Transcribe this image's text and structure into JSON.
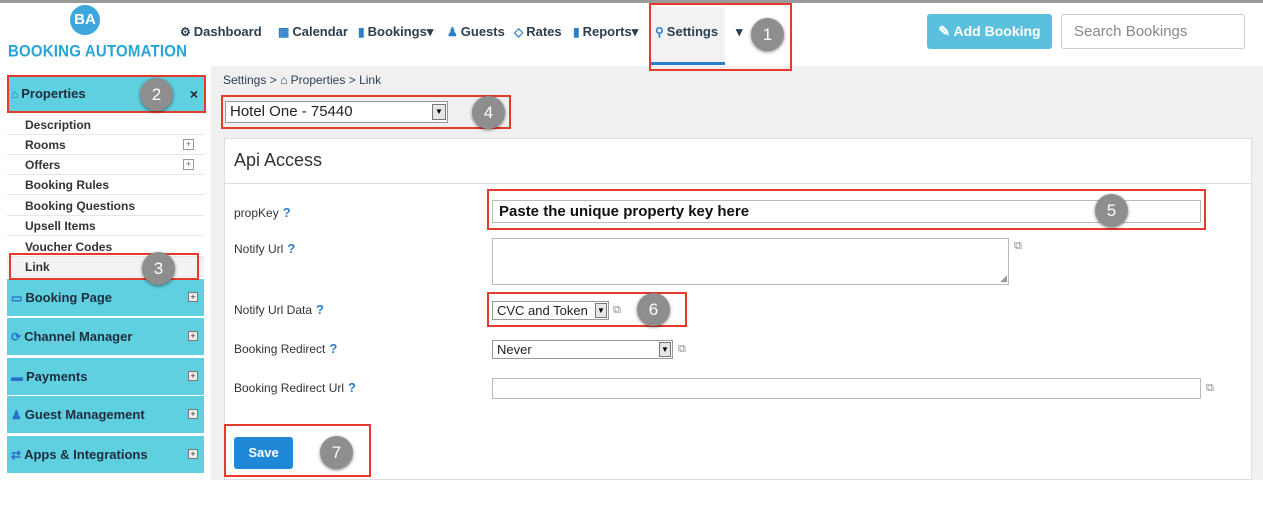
{
  "brand": {
    "logo_mark": "BA",
    "logo_text": "BOOKING AUTOMATION"
  },
  "nav": {
    "items": [
      {
        "label": "Dashboard",
        "icon": "dashboard-icon",
        "glyph": "⚙"
      },
      {
        "label": "Calendar",
        "icon": "calendar-icon",
        "glyph": "▦"
      },
      {
        "label": "Bookings",
        "icon": "bookings-icon",
        "glyph": "▮",
        "caret": "▾"
      },
      {
        "label": "Guests",
        "icon": "guests-icon",
        "glyph": "♟"
      },
      {
        "label": "Rates",
        "icon": "rates-icon",
        "glyph": "◇"
      },
      {
        "label": "Reports",
        "icon": "reports-icon",
        "glyph": "▮",
        "caret": "▾"
      },
      {
        "label": "Settings",
        "icon": "settings-icon",
        "glyph": "⚲"
      }
    ],
    "more_caret": "▾",
    "add_booking": "Add Booking",
    "search_placeholder": "Search Bookings"
  },
  "sidebar": {
    "properties": {
      "label": "Properties",
      "close": "×"
    },
    "sub_items": [
      "Description",
      "Rooms",
      "Offers",
      "Booking Rules",
      "Booking Questions",
      "Upsell Items",
      "Voucher Codes",
      "Link"
    ],
    "sections": [
      "Booking Page",
      "Channel Manager",
      "Payments",
      "Guest Management",
      "Apps & Integrations"
    ]
  },
  "breadcrumb": {
    "root": "Settings",
    "sep": ">",
    "mid": "Properties",
    "leaf": "Link"
  },
  "property_select": {
    "value": "Hotel One - 75440"
  },
  "panel": {
    "title": "Api Access",
    "fields": {
      "propkey": {
        "label": "propKey",
        "value": "Paste the unique property key here"
      },
      "notify_url": {
        "label": "Notify Url",
        "value": ""
      },
      "notify_url_data": {
        "label": "Notify Url Data",
        "value": "CVC and Token"
      },
      "booking_redirect": {
        "label": "Booking Redirect",
        "value": "Never"
      },
      "booking_redirect_url": {
        "label": "Booking Redirect Url",
        "value": ""
      }
    },
    "help_mark": "?",
    "save": "Save"
  },
  "annotations": [
    "1",
    "2",
    "3",
    "4",
    "5",
    "6",
    "7"
  ],
  "colors": {
    "accent": "#5bc0de",
    "sidebar": "#5fd0e0",
    "save": "#1e88d6",
    "annotation": "#e53a2c"
  }
}
